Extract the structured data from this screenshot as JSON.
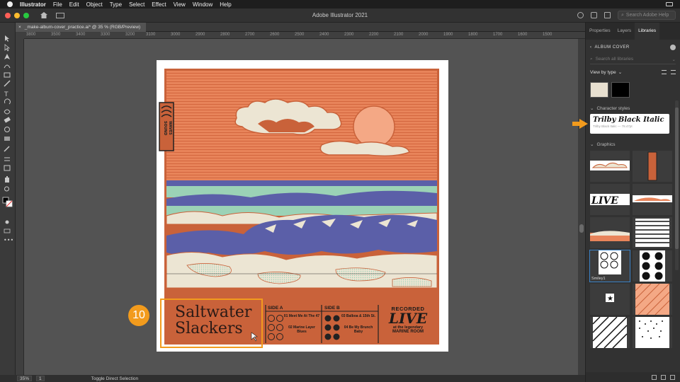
{
  "menubar": {
    "app_name": "Illustrator",
    "items": [
      "File",
      "Edit",
      "Object",
      "Type",
      "Select",
      "Effect",
      "View",
      "Window",
      "Help"
    ]
  },
  "window": {
    "title": "Adobe Illustrator 2021",
    "search_placeholder": "Search Adobe Help"
  },
  "document_tab": {
    "label": "_make-album-cover_practice.ai* @ 35 % (RGB/Preview)",
    "close": "×"
  },
  "ruler": {
    "ticks": [
      "3800",
      "3500",
      "3400",
      "3300",
      "3200",
      "3100",
      "3000",
      "2900",
      "2800",
      "2700",
      "2600",
      "2500",
      "2400",
      "2300",
      "2200",
      "2100",
      "2000",
      "1900",
      "1800",
      "1700",
      "1600",
      "1500"
    ]
  },
  "statusbar": {
    "zoom": "35%",
    "page": "1",
    "tool_hint": "Toggle Direct Selection"
  },
  "panel": {
    "tabs": [
      "Properties",
      "Layers",
      "Libraries"
    ],
    "active_tab": "Libraries",
    "library_name": "ALBUM COVER",
    "search_placeholder": "Search all libraries",
    "view_by": "View by type",
    "swatch_colors": [
      "#e8e0d0",
      "#000000"
    ],
    "character_styles_heading": "Character styles",
    "character_style_name": "Trilby Black Italic",
    "character_style_meta": "Trilby Black Italic — 78.47pt",
    "graphics_heading": "Graphics",
    "selected_graphic_label": "Smiley1"
  },
  "artwork": {
    "band_title_line1": "Saltwater",
    "band_title_line2": "Slackers",
    "logo_text": "SOUND WAVES",
    "side_a_label": "SIDE A",
    "side_b_label": "SIDE B",
    "track_01a": "01 Meet Me At The 47",
    "track_02a": "02 Marine Layer Blues",
    "track_03b": "03 Balboa & 15th St.",
    "track_04b": "04 Be My Brunch Baby",
    "recorded": "RECORDED",
    "live": "LIVE",
    "at_legendary": "at the legendary",
    "venue": "MARINE ROOM",
    "colors": {
      "sky_orange": "#e8845a",
      "cloud_cream": "#ece5d3",
      "sun_peach": "#f4a885",
      "wave_purple": "#5b5fa8",
      "sea_mint": "#9bd2b6",
      "frame_rust": "#c9623a"
    }
  },
  "tutorial": {
    "step_number": "10"
  }
}
